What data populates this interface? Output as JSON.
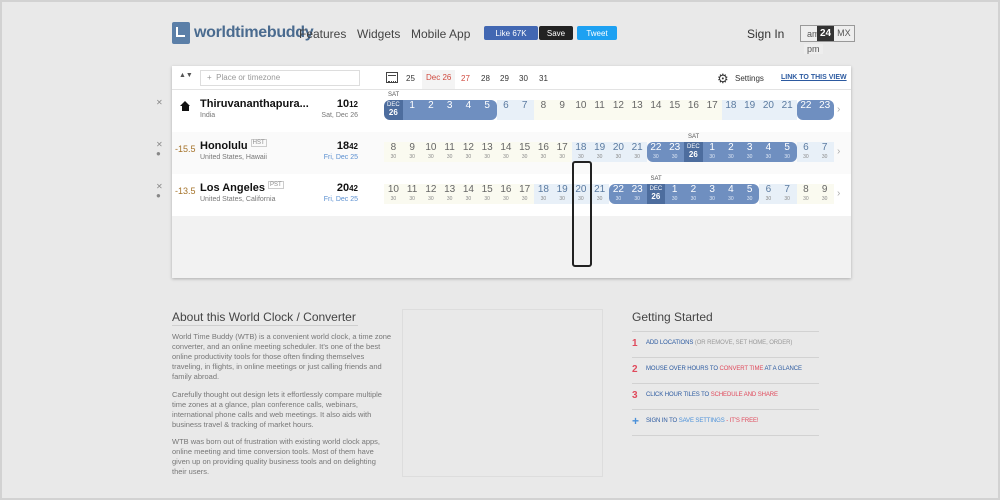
{
  "header": {
    "logo_text": "worldtimebuddy",
    "nav": [
      "Features",
      "Widgets",
      "Mobile App"
    ],
    "fb_like": "Like 67K",
    "save": "Save",
    "tweet": "Tweet",
    "signin": "Sign In",
    "fmt_ampm_top": "am",
    "fmt_ampm_bottom": "pm",
    "fmt_24": "24",
    "fmt_mx": "MX"
  },
  "toolbar": {
    "placeholder": "Place or timezone",
    "add_symbol": "+",
    "dates": [
      "25",
      "Dec 26",
      "27",
      "28",
      "29",
      "30",
      "31"
    ],
    "settings": "Settings",
    "link_view": "LINK TO THIS VIEW"
  },
  "locations": [
    {
      "name": "Thiruvananthapura...",
      "country": "India",
      "time": "10",
      "time_min": "12",
      "day": "Sat, Dec 26",
      "offset": "",
      "tz": ""
    },
    {
      "name": "Honolulu",
      "country": "United States, Hawaii",
      "time": "18",
      "time_min": "42",
      "day": "Fri, Dec 25",
      "offset": "-15.5",
      "tz": "HST"
    },
    {
      "name": "Los Angeles",
      "country": "United States, California",
      "time": "20",
      "time_min": "42",
      "day": "Fri, Dec 25",
      "offset": "-13.5",
      "tz": "PST"
    }
  ],
  "strips": [
    {
      "hours": [
        "DEC 26",
        "1",
        "2",
        "3",
        "4",
        "5",
        "6",
        "7",
        "8",
        "9",
        "10",
        "11",
        "12",
        "13",
        "14",
        "15",
        "16",
        "17",
        "18",
        "19",
        "20",
        "21",
        "22",
        "23"
      ],
      "minutes": false,
      "sat_index": 0
    },
    {
      "hours": [
        "8",
        "9",
        "10",
        "11",
        "12",
        "13",
        "14",
        "15",
        "16",
        "17",
        "18",
        "19",
        "20",
        "21",
        "22",
        "23",
        "DEC 26",
        "1",
        "2",
        "3",
        "4",
        "5",
        "6",
        "7"
      ],
      "minutes": true,
      "sat_index": 16
    },
    {
      "hours": [
        "10",
        "11",
        "12",
        "13",
        "14",
        "15",
        "16",
        "17",
        "18",
        "19",
        "20",
        "21",
        "22",
        "23",
        "DEC 26",
        "1",
        "2",
        "3",
        "4",
        "5",
        "6",
        "7",
        "8",
        "9"
      ],
      "minutes": true,
      "sat_index": 14
    }
  ],
  "minute_label": "30",
  "sat_label": "SAT",
  "about": {
    "title": "About this World Clock / Converter",
    "p1": "World Time Buddy (WTB) is a convenient world clock, a time zone converter, and an online meeting scheduler. It's one of the best online productivity tools for those often finding themselves traveling, in flights, in online meetings or just calling friends and family abroad.",
    "p2": "Carefully thought out design lets it effortlessly compare multiple time zones at a glance, plan conference calls, webinars, international phone calls and web meetings. It also aids with business travel & tracking of market hours.",
    "p3": "WTB was born out of frustration with existing world clock apps, online meeting and time conversion tools. Most of them have given up on providing quality business tools and on delighting their users."
  },
  "getting_started": {
    "title": "Getting Started",
    "items": [
      {
        "num": "1",
        "a": "ADD LOCATIONS",
        "b": " (OR REMOVE, SET HOME, ORDER)"
      },
      {
        "num": "2",
        "a": "MOUSE OVER HOURS TO ",
        "b": "CONVERT TIME",
        "c": " AT A GLANCE"
      },
      {
        "num": "3",
        "a": "CLICK HOUR TILES TO ",
        "b": "SCHEDULE AND SHARE"
      },
      {
        "num": "+",
        "a": "SIGN IN TO ",
        "b": "SAVE SETTINGS",
        "c": " - IT'S FREE!"
      }
    ]
  },
  "colors": {
    "night": "#6f8fc0",
    "accent_red": "#d04a3f",
    "link_blue": "#2c5aa0"
  }
}
